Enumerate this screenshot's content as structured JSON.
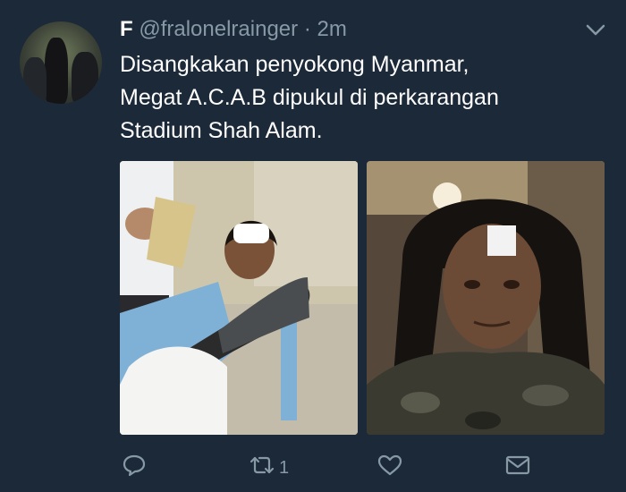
{
  "tweet": {
    "display_name": "F",
    "handle": "@fralonelrainger",
    "separator": "·",
    "time": "2m",
    "text_lines": [
      "Disangkakan penyokong Myanmar,",
      "Megat A.C.A.B dipukul di perkarangan",
      "Stadium Shah Alam."
    ]
  },
  "media": {
    "count": 2,
    "photo_1": "hospital-bed-photo",
    "photo_2": "selfie-head-bandage-photo"
  },
  "actions": {
    "reply_icon": "reply-icon",
    "retweet_icon": "retweet-icon",
    "retweet_count": "1",
    "like_icon": "heart-icon",
    "dm_icon": "envelope-icon"
  },
  "colors": {
    "background": "#1c2938",
    "text": "#ffffff",
    "muted": "#8899a6"
  }
}
